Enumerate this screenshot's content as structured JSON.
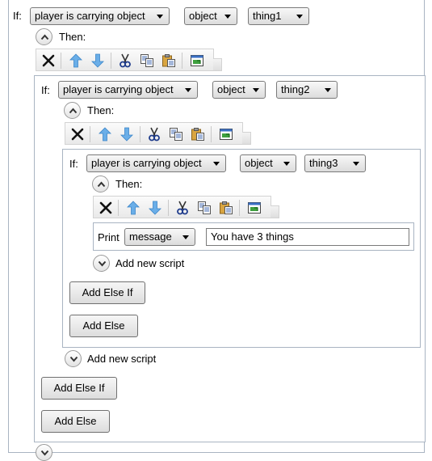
{
  "labels": {
    "if": "If:",
    "then": "Then:",
    "print": "Print",
    "add_new_script": "Add new script",
    "add_else_if": "Add Else If",
    "add_else": "Add Else"
  },
  "level1": {
    "condition": "player is carrying object",
    "type": "object",
    "object": "thing1"
  },
  "level2": {
    "condition": "player is carrying object",
    "type": "object",
    "object": "thing2"
  },
  "level3": {
    "condition": "player is carrying object",
    "type": "object",
    "object": "thing3"
  },
  "print_command": {
    "mode": "message",
    "text": "You have 3 things"
  },
  "toolbar_icons": [
    "delete-icon",
    "move-up-icon",
    "move-down-icon",
    "cut-icon",
    "copy-icon",
    "paste-icon",
    "popout-icon"
  ]
}
